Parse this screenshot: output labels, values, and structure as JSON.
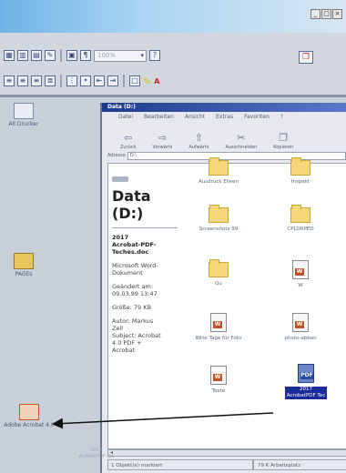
{
  "top_window": {
    "buttons": {
      "minimize": "_",
      "maximize": "□",
      "close": "×"
    },
    "font_size_combo": "100%",
    "toolbar_icons": [
      "table-icon",
      "columns-icon",
      "chart-icon",
      "drawing-icon",
      "document-map-icon",
      "pilcrow-icon",
      "zoom-combo",
      "help-icon",
      "align-left-icon",
      "align-center-icon",
      "align-right-icon",
      "justify-icon",
      "numbering-icon",
      "bullets-icon",
      "decrease-indent-icon",
      "increase-indent-icon",
      "border-icon",
      "highlight-icon",
      "font-color-icon"
    ]
  },
  "desktop": {
    "icons": [
      {
        "label": "All Drucker"
      },
      {
        "label": "PAGEs"
      },
      {
        "label": "Adobe Acrobat 4.0"
      }
    ]
  },
  "explorer": {
    "title": "Data (D:)",
    "menu": [
      "Datei",
      "Bearbeiten",
      "Ansicht",
      "Extras",
      "Favoriten",
      "?"
    ],
    "toolbar": [
      "Zurück",
      "Vorwärts",
      "Aufwärts",
      "Ausschneiden",
      "Kopieren"
    ],
    "address_label": "Adresse",
    "address_value": "D:\\",
    "drive_title": "Data\n(D:)",
    "info": {
      "filename": "2017\nAcrobat-PDF-\nTeches.doc",
      "type": "Microsoft Word-\nDokument",
      "modified": "Geändert am:\n09.03.99 13:47",
      "size": "Größe: 79 KB",
      "author": "Autor: Markus\nZell\nSubject: Acrobat\n4.0 PDF +\nAcrobat"
    },
    "files": [
      {
        "label": "Ausdruck Eileen",
        "kind": "folder"
      },
      {
        "label": "Inspekt",
        "kind": "folder"
      },
      {
        "label": "Screenshots 99",
        "kind": "folder"
      },
      {
        "label": "CPLORPED",
        "kind": "folder"
      },
      {
        "label": "Qu",
        "kind": "folder"
      },
      {
        "label": "W",
        "kind": "doc"
      },
      {
        "label": "Bitte Tage für Foto",
        "kind": "doc"
      },
      {
        "label": "photo-abban",
        "kind": "doc"
      },
      {
        "label": "Texte",
        "kind": "doc"
      },
      {
        "label": "2017\nAcrobatPDF Tec",
        "kind": "doc",
        "selected": true
      }
    ],
    "status_left": "1 Objekt(e) markiert",
    "status_right": "79 K  Arbeitsplatz"
  },
  "drag_ghost_label": "2017\nAcrobatPDF Tec"
}
